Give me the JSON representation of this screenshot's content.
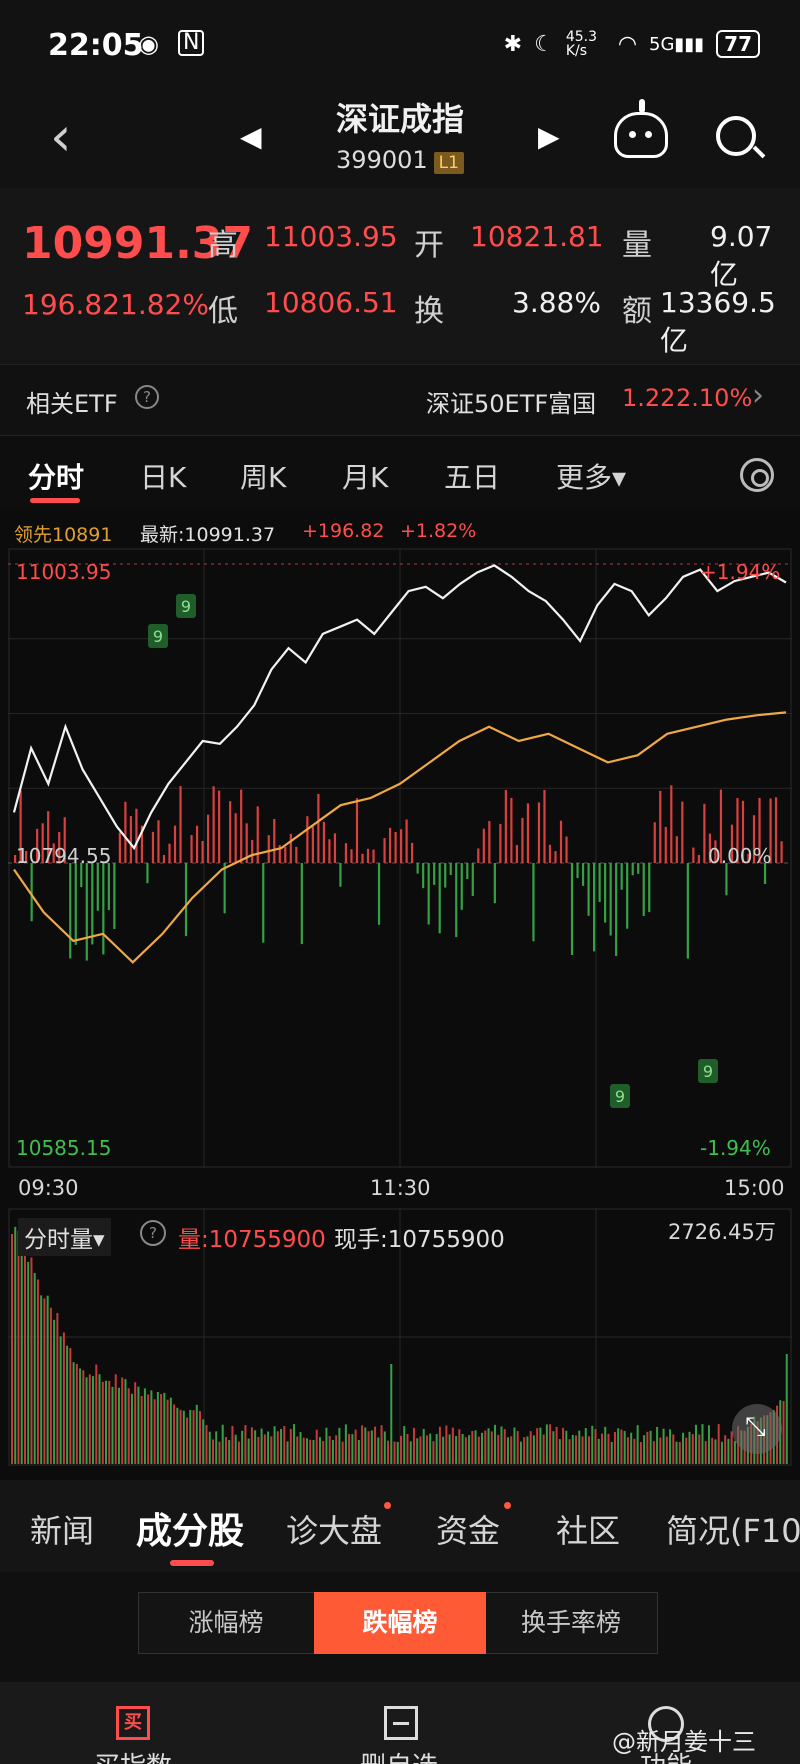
{
  "status_bar": {
    "time": "22:05",
    "speed": "45.3 K/s",
    "battery": "77",
    "icons": [
      "eye-icon",
      "nfc-icon",
      "bluetooth-icon",
      "moon-icon",
      "wifi-icon",
      "5g-signal-icon",
      "battery-icon"
    ]
  },
  "header": {
    "name": "深证成指",
    "code": "399001",
    "level_badge": "L1"
  },
  "quote": {
    "last_price": "10991.37",
    "change_abs": "196.82",
    "change_pct": "1.82%",
    "high_label": "高",
    "high": "11003.95",
    "open_label": "开",
    "open": "10821.81",
    "volume_label": "量",
    "volume": "9.07亿",
    "low_label": "低",
    "low": "10806.51",
    "turnover_label": "换",
    "turnover": "3.88%",
    "amount_label": "额",
    "amount": "13369.5亿"
  },
  "etf": {
    "label": "相关ETF",
    "help": "?",
    "name": "深证50ETF富国",
    "price": "1.22",
    "pct": "2.10%"
  },
  "tabs": [
    "分时",
    "日K",
    "周K",
    "月K",
    "五日",
    "更多▾"
  ],
  "info_line": {
    "leader": "领先10891",
    "latest": "最新:10991.37",
    "chg": "+196.82",
    "pct": "+1.82%"
  },
  "chart_labels": {
    "y_top": "11003.95",
    "y_mid": "10794.55",
    "y_bottom": "10585.15",
    "pct_top": "+1.94%",
    "pct_mid": "0.00%",
    "pct_bottom": "-1.94%",
    "marker": "9",
    "time_ticks": [
      "09:30",
      "11:30",
      "15:00"
    ]
  },
  "chart_data": {
    "type": "line",
    "ylim": [
      10585.15,
      11003.95
    ],
    "prev_close": 10794.55,
    "series": [
      {
        "values": [
          10830,
          10875,
          10850,
          10890,
          10860,
          10840,
          10820,
          10805,
          10830,
          10850,
          10865,
          10880,
          10878,
          10890,
          10905,
          10930,
          10945,
          10935,
          10955,
          10960,
          10965,
          10955,
          10970,
          10985,
          10988,
          10980,
          10990,
          10998,
          11003,
          10995,
          10985,
          10978,
          10965,
          10950,
          10975,
          10990,
          10985,
          10968,
          10980,
          10995,
          11000,
          10985,
          10992,
          10995,
          10998,
          10991
        ]
      },
      {
        "values": [
          10790,
          10760,
          10740,
          10745,
          10725,
          10745,
          10770,
          10790,
          10800,
          10805,
          10820,
          10835,
          10840,
          10850,
          10865,
          10880,
          10890,
          10880,
          10885,
          10875,
          10865,
          10870,
          10885,
          10890,
          10895,
          10898,
          10900
        ]
      }
    ]
  },
  "volume": {
    "mode": "分时量▾",
    "help": "?",
    "label": "量:10755900",
    "current": "现手:10755900",
    "max": "2726.45万"
  },
  "section_tabs": [
    "新闻",
    "成分股",
    "诊大盘",
    "资金",
    "社区",
    "简况(F10"
  ],
  "rank": [
    "涨幅榜",
    "跌幅榜",
    "换手率榜"
  ],
  "bottom_nav": [
    "买指数",
    "删自选",
    "功能"
  ],
  "watermark": "@新月姜十三"
}
